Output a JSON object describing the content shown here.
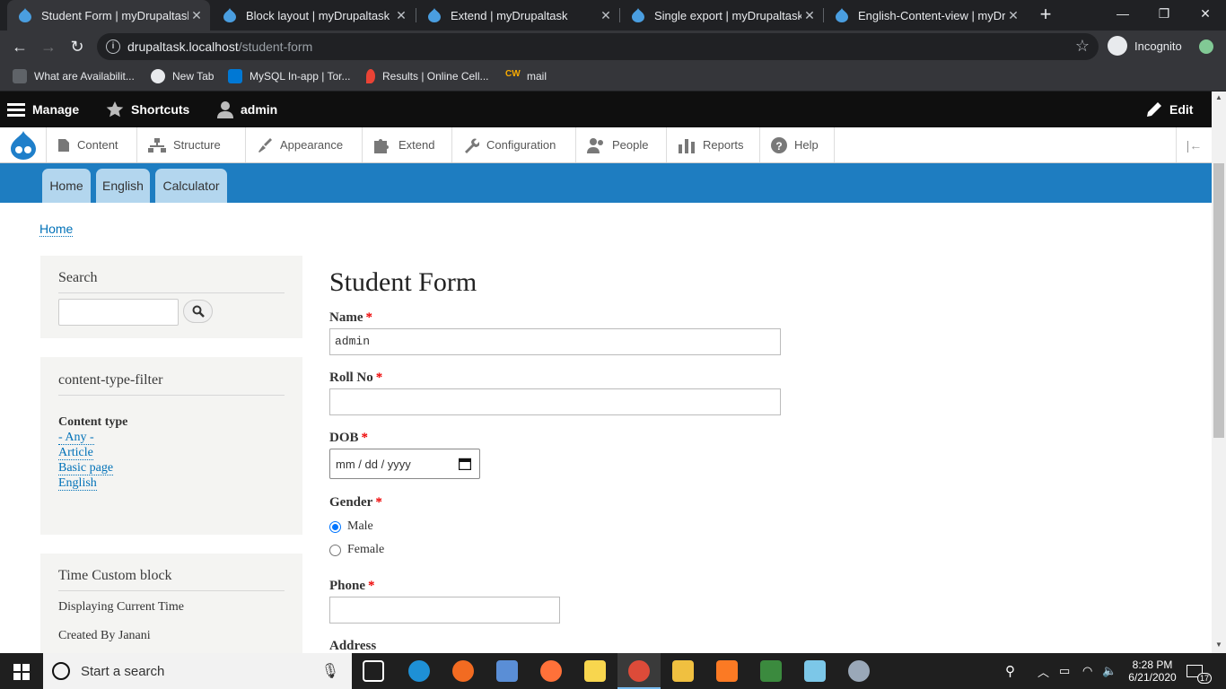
{
  "browser": {
    "tabs": [
      {
        "title": "Student Form | myDrupaltask",
        "active": true
      },
      {
        "title": "Block layout | myDrupaltask",
        "active": false
      },
      {
        "title": "Extend | myDrupaltask",
        "active": false
      },
      {
        "title": "Single export | myDrupaltask",
        "active": false
      },
      {
        "title": "English-Content-view | myDrupaltask",
        "active": false
      }
    ],
    "url_host": "drupaltask.localhost",
    "url_path": "/student-form",
    "profile_label": "Incognito",
    "bookmarks": [
      {
        "label": "What are Availabilit...",
        "icon": "cloud-icon"
      },
      {
        "label": "New Tab",
        "icon": "chrome-icon"
      },
      {
        "label": "MySQL In-app | Tor...",
        "icon": "azure-icon"
      },
      {
        "label": "Results | Online Cell...",
        "icon": "map-pin-icon"
      },
      {
        "label": "mail",
        "icon": "cw-icon"
      }
    ]
  },
  "drupal_toolbar": {
    "manage": "Manage",
    "shortcuts": "Shortcuts",
    "user": "admin",
    "edit": "Edit",
    "menu": [
      {
        "label": "Content",
        "icon": "file-icon"
      },
      {
        "label": "Structure",
        "icon": "sitemap-icon"
      },
      {
        "label": "Appearance",
        "icon": "paint-brush-icon"
      },
      {
        "label": "Extend",
        "icon": "puzzle-icon"
      },
      {
        "label": "Configuration",
        "icon": "wrench-icon"
      },
      {
        "label": "People",
        "icon": "people-icon"
      },
      {
        "label": "Reports",
        "icon": "bar-chart-icon"
      },
      {
        "label": "Help",
        "icon": "help-icon"
      }
    ]
  },
  "site_nav": [
    "Home",
    "English",
    "Calculator"
  ],
  "breadcrumb": "Home",
  "sidebar": {
    "search": {
      "title": "Search"
    },
    "filter": {
      "title": "content-type-filter",
      "label": "Content type",
      "links": [
        "- Any -",
        "Article",
        "Basic page",
        "English"
      ]
    },
    "time": {
      "title": "Time Custom block",
      "lines": [
        "Displaying Current Time",
        "Created By Janani"
      ]
    }
  },
  "form": {
    "title": "Student Form",
    "name_label": "Name",
    "name_value": "admin",
    "rollno_label": "Roll No",
    "dob_label": "DOB",
    "dob_placeholder": "mm / dd / yyyy",
    "gender_label": "Gender",
    "gender_options": [
      "Male",
      "Female"
    ],
    "gender_selected": "Male",
    "phone_label": "Phone",
    "address_label": "Address",
    "required_mark": "*"
  },
  "taskbar": {
    "search_placeholder": "Start a search",
    "time": "8:28 PM",
    "date": "6/21/2020",
    "notifications": "17"
  },
  "colors": {
    "site_header": "#1e7dc1",
    "tab_bg": "#b3d6ee",
    "link": "#0071b8",
    "required": "#e00000"
  }
}
